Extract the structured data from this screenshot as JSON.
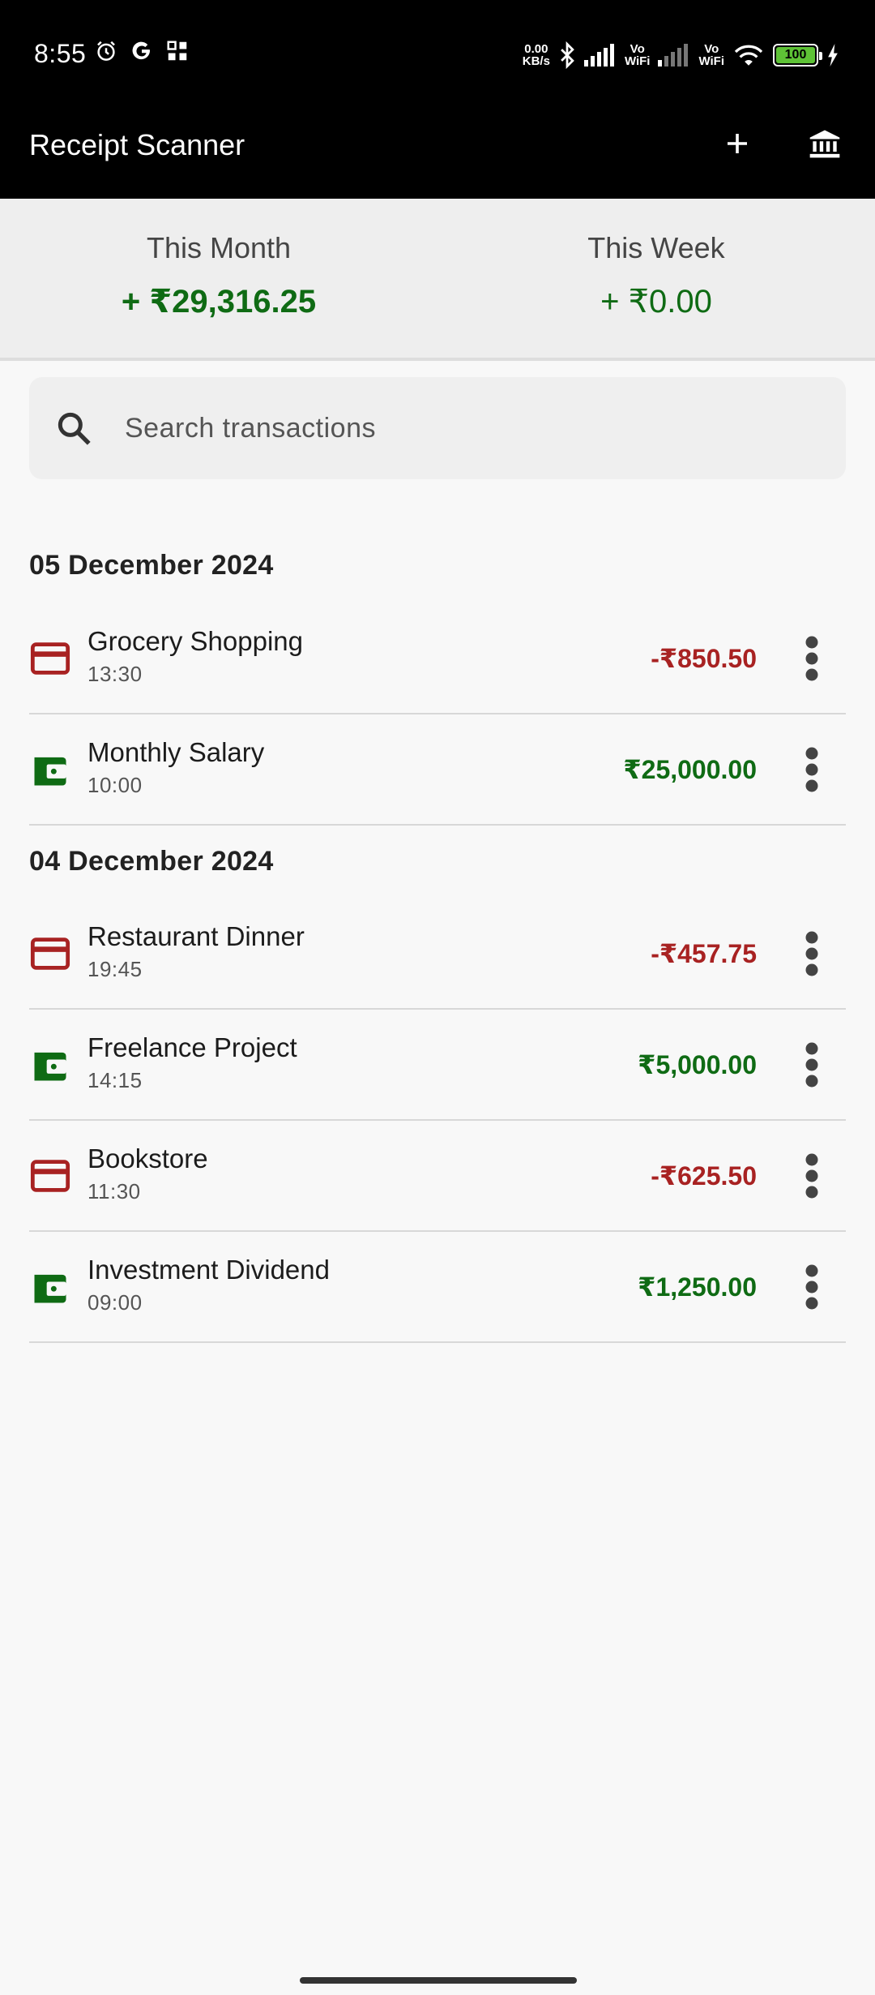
{
  "status_bar": {
    "time": "8:55",
    "net_speed_value": "0.00",
    "net_speed_unit": "KB/s",
    "vowifi_1_top": "Vo",
    "vowifi_1_bottom": "WiFi",
    "vowifi_2_top": "Vo",
    "vowifi_2_bottom": "WiFi",
    "battery": "100"
  },
  "app_bar": {
    "title": "Receipt Scanner",
    "icons": [
      "add-icon",
      "bank-icon"
    ]
  },
  "summary": {
    "month_label": "This Month",
    "month_value": "+ ₹29,316.25",
    "week_label": "This Week",
    "week_value": "+ ₹0.00"
  },
  "search": {
    "placeholder": "Search transactions"
  },
  "groups": [
    {
      "date": "05 December 2024",
      "items": [
        {
          "title": "Grocery Shopping",
          "time": "13:30",
          "amount": "-₹850.50",
          "type": "expense"
        },
        {
          "title": "Monthly Salary",
          "time": "10:00",
          "amount": "₹25,000.00",
          "type": "income"
        }
      ]
    },
    {
      "date": "04 December 2024",
      "items": [
        {
          "title": "Restaurant Dinner",
          "time": "19:45",
          "amount": "-₹457.75",
          "type": "expense"
        },
        {
          "title": "Freelance Project",
          "time": "14:15",
          "amount": "₹5,000.00",
          "type": "income"
        },
        {
          "title": "Bookstore",
          "time": "11:30",
          "amount": "-₹625.50",
          "type": "expense"
        },
        {
          "title": "Investment Dividend",
          "time": "09:00",
          "amount": "₹1,250.00",
          "type": "income"
        }
      ]
    }
  ],
  "colors": {
    "expense": "#a82222",
    "income": "#0f6b14"
  }
}
